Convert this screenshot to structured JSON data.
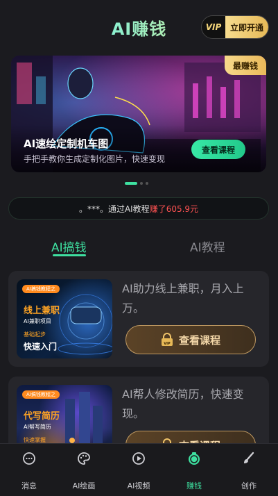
{
  "header": {
    "title": "AI赚钱",
    "vip_left": "VIP",
    "vip_right": "立即开通"
  },
  "banner": {
    "badge": "最赚钱",
    "title": "AI速绘定制机车图",
    "subtitle": "手把手教你生成定制化图片，快速变现",
    "button": "查看课程"
  },
  "ticker": {
    "name": "。***。通过AI教程",
    "earned": "赚了605.9元"
  },
  "tabs": [
    {
      "label": "AI搞钱"
    },
    {
      "label": "AI教程"
    }
  ],
  "cards": [
    {
      "tag": "AI搞钱教程之",
      "thumb_big": "线上兼职",
      "thumb_small": "AI兼职项目",
      "thumb_orange": "基础起步",
      "thumb_white": "快速入门",
      "text": "AI助力线上兼职，月入上万。",
      "button": "查看课程"
    },
    {
      "tag": "AI搞钱教程之",
      "thumb_big": "代写简历",
      "thumb_small": "AI帮写简历",
      "thumb_orange": "快速掌握",
      "thumb_white": "",
      "text": "AI帮人修改简历，快速变现。",
      "button": "查看课程"
    }
  ],
  "nav": [
    {
      "label": "消息",
      "icon": "chat-bubble-icon"
    },
    {
      "label": "AI绘画",
      "icon": "palette-icon"
    },
    {
      "label": "AI视频",
      "icon": "play-circle-icon"
    },
    {
      "label": "赚钱",
      "icon": "money-bag-icon"
    },
    {
      "label": "创作",
      "icon": "brush-icon"
    }
  ],
  "colors": {
    "accent": "#3ee0a0",
    "background": "#1b1b1f",
    "card": "#26262b",
    "gold": "#e7b957",
    "highlight_red": "#ff5252"
  }
}
